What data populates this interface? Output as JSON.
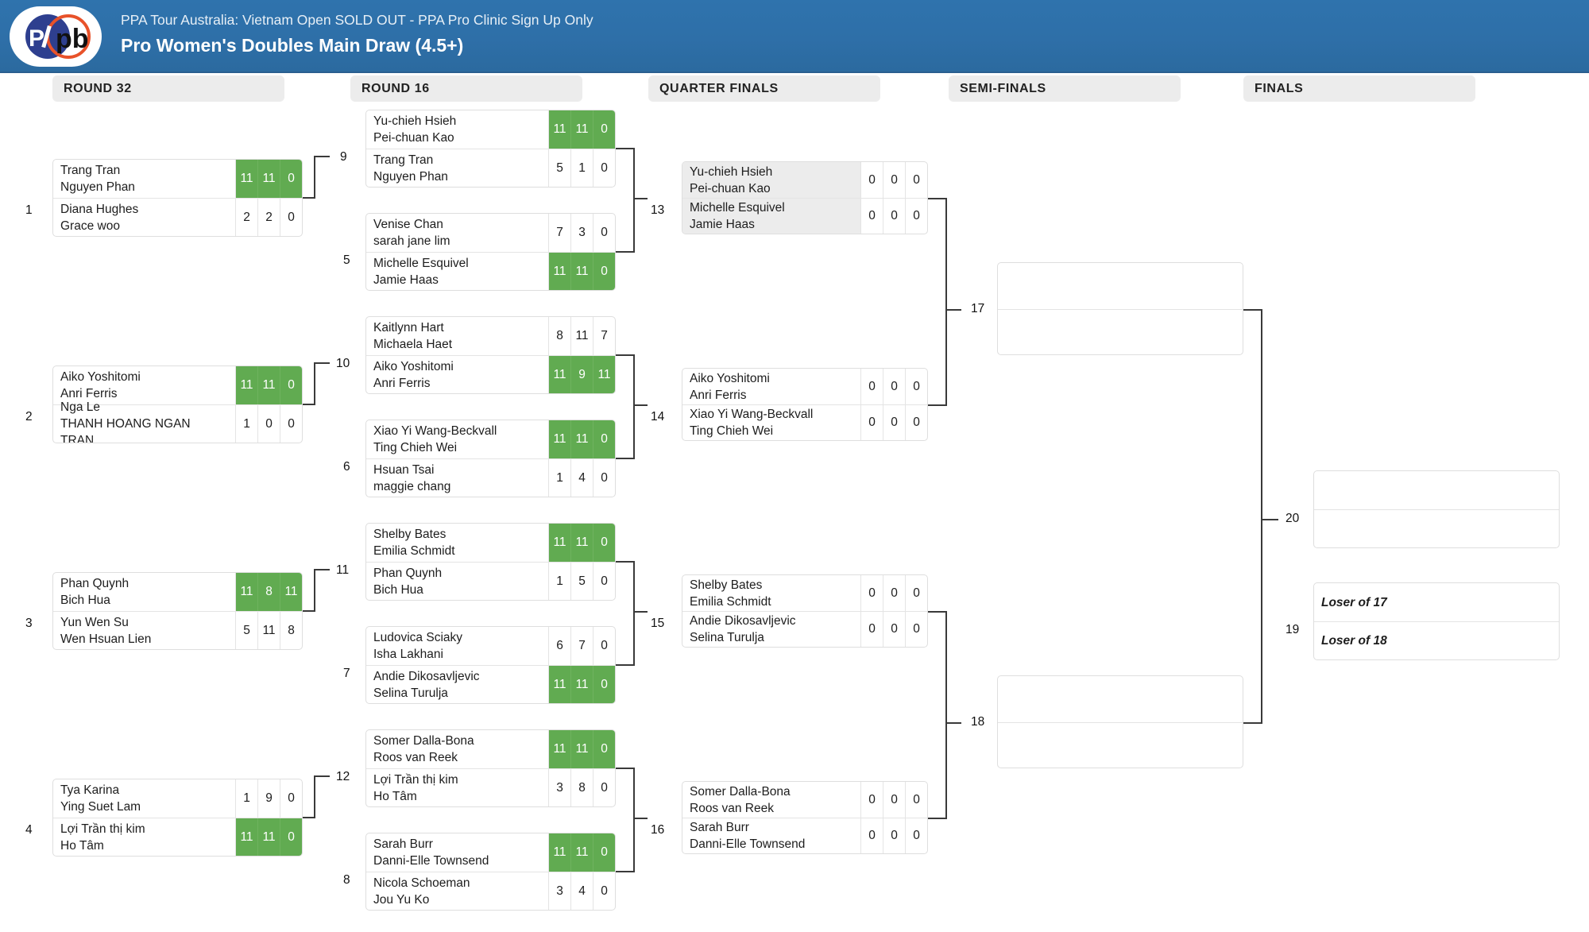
{
  "header": {
    "subtitle": "PPA Tour Australia: Vietnam Open SOLD OUT - PPA Pro Clinic Sign Up Only",
    "title": "Pro Women's Doubles Main Draw (4.5+)",
    "logo_text": "pb",
    "bg_color": "#2e6fa8"
  },
  "colors": {
    "winner_green": "#61ab51",
    "round_header_bg": "#ececec",
    "shaded_match_bg": "#ececec",
    "connector": "#3a3a3a"
  },
  "rounds": [
    {
      "label": "ROUND 32"
    },
    {
      "label": "ROUND 16"
    },
    {
      "label": "QUARTER FINALS"
    },
    {
      "label": "SEMI-FINALS"
    },
    {
      "label": "FINALS"
    }
  ],
  "matches": {
    "m1": {
      "number": "1",
      "top": {
        "p1": "Trang Tran",
        "p2": "Nguyen Phan",
        "s1": "11",
        "s2": "11",
        "s3": "0",
        "winner": true
      },
      "bottom": {
        "p1": "Diana Hughes",
        "p2": "Grace woo",
        "s1": "2",
        "s2": "2",
        "s3": "0",
        "winner": false
      }
    },
    "m2": {
      "number": "2",
      "top": {
        "p1": "Aiko Yoshitomi",
        "p2": "Anri Ferris",
        "s1": "11",
        "s2": "11",
        "s3": "0",
        "winner": true
      },
      "bottom": {
        "p1": "Nga Le",
        "p2": "THANH HOANG NGAN TRAN",
        "s1": "1",
        "s2": "0",
        "s3": "0",
        "winner": false
      }
    },
    "m3": {
      "number": "3",
      "top": {
        "p1": "Phan Quynh",
        "p2": "Bich Hua",
        "s1": "11",
        "s2": "8",
        "s3": "11",
        "winner": true
      },
      "bottom": {
        "p1": "Yun Wen Su",
        "p2": "Wen Hsuan Lien",
        "s1": "5",
        "s2": "11",
        "s3": "8",
        "winner": false
      }
    },
    "m4": {
      "number": "4",
      "top": {
        "p1": "Tya Karina",
        "p2": "Ying Suet Lam",
        "s1": "1",
        "s2": "9",
        "s3": "0",
        "winner": false
      },
      "bottom": {
        "p1": "Lợi Trần thị kim",
        "p2": "Ho Tâm",
        "s1": "11",
        "s2": "11",
        "s3": "0",
        "winner": true
      }
    },
    "m9": {
      "number": "9",
      "top": {
        "p1": "Yu-chieh Hsieh",
        "p2": "Pei-chuan Kao",
        "s1": "11",
        "s2": "11",
        "s3": "0",
        "winner": true
      },
      "bottom": {
        "p1": "Trang Tran",
        "p2": "Nguyen Phan",
        "s1": "5",
        "s2": "1",
        "s3": "0",
        "winner": false
      }
    },
    "m5": {
      "number": "5",
      "top": {
        "p1": "Venise Chan",
        "p2": "sarah jane lim",
        "s1": "7",
        "s2": "3",
        "s3": "0",
        "winner": false
      },
      "bottom": {
        "p1": "Michelle Esquivel",
        "p2": "Jamie Haas",
        "s1": "11",
        "s2": "11",
        "s3": "0",
        "winner": true
      }
    },
    "m10": {
      "number": "10",
      "top": {
        "p1": "Kaitlynn Hart",
        "p2": "Michaela Haet",
        "s1": "8",
        "s2": "11",
        "s3": "7",
        "winner": false
      },
      "bottom": {
        "p1": "Aiko Yoshitomi",
        "p2": "Anri Ferris",
        "s1": "11",
        "s2": "9",
        "s3": "11",
        "winner": true
      }
    },
    "m6": {
      "number": "6",
      "top": {
        "p1": "Xiao Yi Wang-Beckvall",
        "p2": "Ting Chieh Wei",
        "s1": "11",
        "s2": "11",
        "s3": "0",
        "winner": true
      },
      "bottom": {
        "p1": "Hsuan Tsai",
        "p2": "maggie chang",
        "s1": "1",
        "s2": "4",
        "s3": "0",
        "winner": false
      }
    },
    "m11": {
      "number": "11",
      "top": {
        "p1": "Shelby Bates",
        "p2": "Emilia Schmidt",
        "s1": "11",
        "s2": "11",
        "s3": "0",
        "winner": true
      },
      "bottom": {
        "p1": "Phan Quynh",
        "p2": "Bich Hua",
        "s1": "1",
        "s2": "5",
        "s3": "0",
        "winner": false
      }
    },
    "m7": {
      "number": "7",
      "top": {
        "p1": "Ludovica Sciaky",
        "p2": "Isha Lakhani",
        "s1": "6",
        "s2": "7",
        "s3": "0",
        "winner": false
      },
      "bottom": {
        "p1": "Andie Dikosavljevic",
        "p2": "Selina Turulja",
        "s1": "11",
        "s2": "11",
        "s3": "0",
        "winner": true
      }
    },
    "m12": {
      "number": "12",
      "top": {
        "p1": "Somer Dalla-Bona",
        "p2": "Roos van Reek",
        "s1": "11",
        "s2": "11",
        "s3": "0",
        "winner": true
      },
      "bottom": {
        "p1": "Lợi Trần thị kim",
        "p2": "Ho Tâm",
        "s1": "3",
        "s2": "8",
        "s3": "0",
        "winner": false
      }
    },
    "m8": {
      "number": "8",
      "top": {
        "p1": "Sarah Burr",
        "p2": "Danni-Elle Townsend",
        "s1": "11",
        "s2": "11",
        "s3": "0",
        "winner": true
      },
      "bottom": {
        "p1": "Nicola Schoeman",
        "p2": "Jou Yu Ko",
        "s1": "3",
        "s2": "4",
        "s3": "0",
        "winner": false
      }
    },
    "m13": {
      "number": "13",
      "shaded": true,
      "top": {
        "p1": "Yu-chieh Hsieh",
        "p2": "Pei-chuan Kao",
        "s1": "0",
        "s2": "0",
        "s3": "0",
        "winner": false
      },
      "bottom": {
        "p1": "Michelle Esquivel",
        "p2": "Jamie Haas",
        "s1": "0",
        "s2": "0",
        "s3": "0",
        "winner": false
      }
    },
    "m14": {
      "number": "14",
      "shaded": false,
      "top": {
        "p1": "Aiko Yoshitomi",
        "p2": "Anri Ferris",
        "s1": "0",
        "s2": "0",
        "s3": "0",
        "winner": false
      },
      "bottom": {
        "p1": "Xiao Yi Wang-Beckvall",
        "p2": "Ting Chieh Wei",
        "s1": "0",
        "s2": "0",
        "s3": "0",
        "winner": false
      }
    },
    "m15": {
      "number": "15",
      "shaded": false,
      "top": {
        "p1": "Shelby Bates",
        "p2": "Emilia Schmidt",
        "s1": "0",
        "s2": "0",
        "s3": "0",
        "winner": false
      },
      "bottom": {
        "p1": "Andie Dikosavljevic",
        "p2": "Selina Turulja",
        "s1": "0",
        "s2": "0",
        "s3": "0",
        "winner": false
      }
    },
    "m16": {
      "number": "16",
      "shaded": false,
      "top": {
        "p1": "Somer Dalla-Bona",
        "p2": "Roos van Reek",
        "s1": "0",
        "s2": "0",
        "s3": "0",
        "winner": false
      },
      "bottom": {
        "p1": "Sarah Burr",
        "p2": "Danni-Elle Townsend",
        "s1": "0",
        "s2": "0",
        "s3": "0",
        "winner": false
      }
    },
    "m17": {
      "number": "17",
      "top": {
        "p1": "",
        "p2": ""
      },
      "bottom": {
        "p1": "",
        "p2": ""
      }
    },
    "m18": {
      "number": "18",
      "top": {
        "p1": "",
        "p2": ""
      },
      "bottom": {
        "p1": "",
        "p2": ""
      }
    },
    "m20": {
      "number": "20",
      "top": {
        "p1": "",
        "p2": ""
      },
      "bottom": {
        "p1": "",
        "p2": ""
      }
    },
    "m19": {
      "number": "19",
      "top": {
        "p1": "Loser of 17"
      },
      "bottom": {
        "p1": "Loser of 18"
      }
    }
  }
}
